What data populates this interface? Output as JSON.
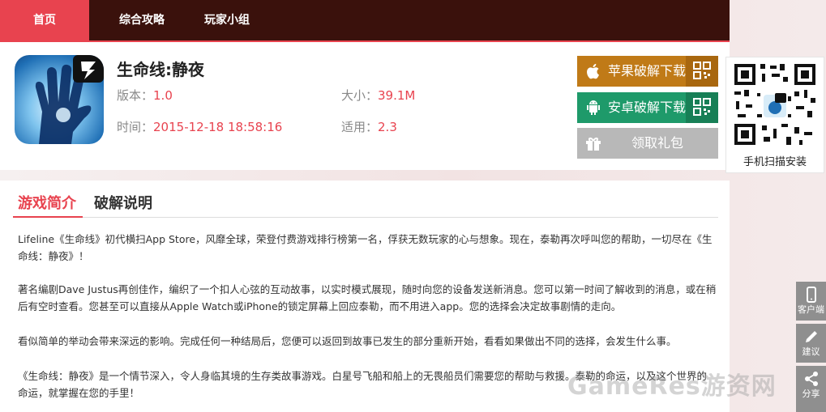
{
  "nav": {
    "items": [
      "首页",
      "综合攻略",
      "玩家小组"
    ]
  },
  "app": {
    "title": "生命线:静夜",
    "version_label": "版本：",
    "version": "1.0",
    "size_label": "大小：",
    "size": "39.1M",
    "time_label": "时间：",
    "time": "2015-12-18 18:58:16",
    "compat_label": "适用：",
    "compat": "2.3"
  },
  "buttons": {
    "ios": "苹果破解下载",
    "android": "安卓破解下载",
    "gift": "领取礼包"
  },
  "qr": {
    "caption": "手机扫描安装"
  },
  "tabs": [
    "游戏简介",
    "破解说明"
  ],
  "description": [
    "Lifeline《生命线》初代横扫App Store，风靡全球，荣登付费游戏排行榜第一名，俘获无数玩家的心与想象。现在，泰勒再次呼叫您的帮助，一切尽在《生命线：静夜》！",
    "著名编剧Dave Justus再创佳作，编织了一个扣人心弦的互动故事，以实时模式展现，随时向您的设备发送新消息。您可以第一时间了解收到的消息，或在稍后有空时查看。您甚至可以直接从Apple Watch或iPhone的锁定屏幕上回应泰勒，而不用进入app。您的选择会决定故事剧情的走向。",
    "看似简单的举动会带来深远的影响。完成任何一种结局后，您便可以返回到故事已发生的部分重新开始，看看如果做出不同的选择，会发生什么事。",
    "《生命线：静夜》是一个情节深入，令人身临其境的生存类故事游戏。白星号飞船和船上的无畏船员们需要您的帮助与救援。泰勒的命运，以及这个世界的命运，就掌握在您的手里！"
  ],
  "side": [
    "客户端",
    "建议",
    "分享"
  ],
  "watermark": "GameRes游资网",
  "colors": {
    "accent": "#e8434f",
    "nav_bg": "#3a110c",
    "ios_btn": "#c07a17",
    "android_btn": "#1e9a6a",
    "gift_btn": "#b8b8b8"
  },
  "icons": [
    "apple-icon",
    "android-icon",
    "gift-icon",
    "qr-icon",
    "phone-icon",
    "pencil-icon",
    "share-icon"
  ]
}
